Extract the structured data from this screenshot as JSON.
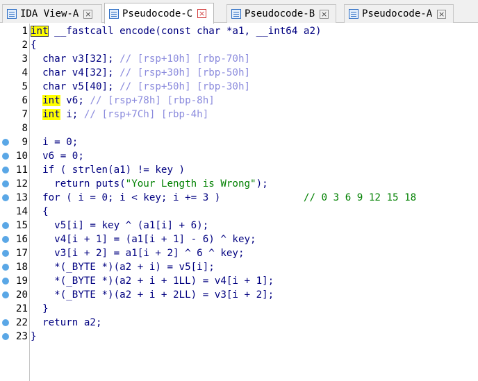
{
  "tabs": [
    {
      "label": "IDA View-A",
      "close": "×",
      "active": false
    },
    {
      "label": "Pseudocode-C",
      "close": "×",
      "active": true
    },
    {
      "label": "Pseudocode-B",
      "close": "×",
      "active": false
    },
    {
      "label": "Pseudocode-A",
      "close": "×",
      "active": false
    }
  ],
  "code": {
    "lines": [
      {
        "num": "1",
        "bp": false,
        "parts": [
          {
            "t": "int",
            "c": "kw"
          },
          {
            "t": " __fastcall encode(const char *a1, __int64 a2)"
          }
        ]
      },
      {
        "num": "2",
        "bp": false,
        "parts": [
          {
            "t": "{"
          }
        ]
      },
      {
        "num": "3",
        "bp": false,
        "parts": [
          {
            "t": "  char v3[32]; "
          },
          {
            "t": "// [rsp+10h] [rbp-70h]",
            "c": "cm"
          }
        ]
      },
      {
        "num": "4",
        "bp": false,
        "parts": [
          {
            "t": "  char v4[32]; "
          },
          {
            "t": "// [rsp+30h] [rbp-50h]",
            "c": "cm"
          }
        ]
      },
      {
        "num": "5",
        "bp": false,
        "parts": [
          {
            "t": "  char v5[40]; "
          },
          {
            "t": "// [rsp+50h] [rbp-30h]",
            "c": "cm"
          }
        ]
      },
      {
        "num": "6",
        "bp": false,
        "parts": [
          {
            "t": "  "
          },
          {
            "t": "int",
            "c": "kw"
          },
          {
            "t": " v6; "
          },
          {
            "t": "// [rsp+78h] [rbp-8h]",
            "c": "cm"
          }
        ]
      },
      {
        "num": "7",
        "bp": false,
        "parts": [
          {
            "t": "  "
          },
          {
            "t": "int",
            "c": "kw"
          },
          {
            "t": " i; "
          },
          {
            "t": "// [rsp+7Ch] [rbp-4h]",
            "c": "cm"
          }
        ]
      },
      {
        "num": "8",
        "bp": false,
        "parts": [
          {
            "t": ""
          }
        ]
      },
      {
        "num": "9",
        "bp": true,
        "parts": [
          {
            "t": "  i = 0;"
          }
        ]
      },
      {
        "num": "10",
        "bp": true,
        "parts": [
          {
            "t": "  v6 = 0;"
          }
        ]
      },
      {
        "num": "11",
        "bp": true,
        "parts": [
          {
            "t": "  if ( strlen(a1) != key )"
          }
        ]
      },
      {
        "num": "12",
        "bp": true,
        "parts": [
          {
            "t": "    return puts("
          },
          {
            "t": "\"Your Length is Wrong\"",
            "c": "str"
          },
          {
            "t": ");"
          }
        ]
      },
      {
        "num": "13",
        "bp": true,
        "parts": [
          {
            "t": "  for ( i = 0; i < key; i += 3 )              "
          },
          {
            "t": "// 0 3 6 9 12 15 18",
            "c": "cm2"
          }
        ]
      },
      {
        "num": "14",
        "bp": false,
        "parts": [
          {
            "t": "  {"
          }
        ]
      },
      {
        "num": "15",
        "bp": true,
        "parts": [
          {
            "t": "    v5[i] = key ^ (a1[i] + 6);"
          }
        ]
      },
      {
        "num": "16",
        "bp": true,
        "parts": [
          {
            "t": "    v4[i + 1] = (a1[i + 1] - 6) ^ key;"
          }
        ]
      },
      {
        "num": "17",
        "bp": true,
        "parts": [
          {
            "t": "    v3[i + 2] = a1[i + 2] ^ 6 ^ key;"
          }
        ]
      },
      {
        "num": "18",
        "bp": true,
        "parts": [
          {
            "t": "    *(_BYTE *)(a2 + i) = v5[i];"
          }
        ]
      },
      {
        "num": "19",
        "bp": true,
        "parts": [
          {
            "t": "    *(_BYTE *)(a2 + i + 1LL) = v4[i + 1];"
          }
        ]
      },
      {
        "num": "20",
        "bp": true,
        "parts": [
          {
            "t": "    *(_BYTE *)(a2 + i + 2LL) = v3[i + 2];"
          }
        ]
      },
      {
        "num": "21",
        "bp": false,
        "parts": [
          {
            "t": "  }"
          }
        ]
      },
      {
        "num": "22",
        "bp": true,
        "parts": [
          {
            "t": "  return a2;"
          }
        ]
      },
      {
        "num": "23",
        "bp": true,
        "parts": [
          {
            "t": "}"
          }
        ]
      }
    ]
  },
  "colors": {
    "keyword_highlight": "#ffff00",
    "code_text": "#000080",
    "comment": "#8b8bdd",
    "green_comment": "#008000",
    "breakpoint": "#5aa7e6"
  }
}
